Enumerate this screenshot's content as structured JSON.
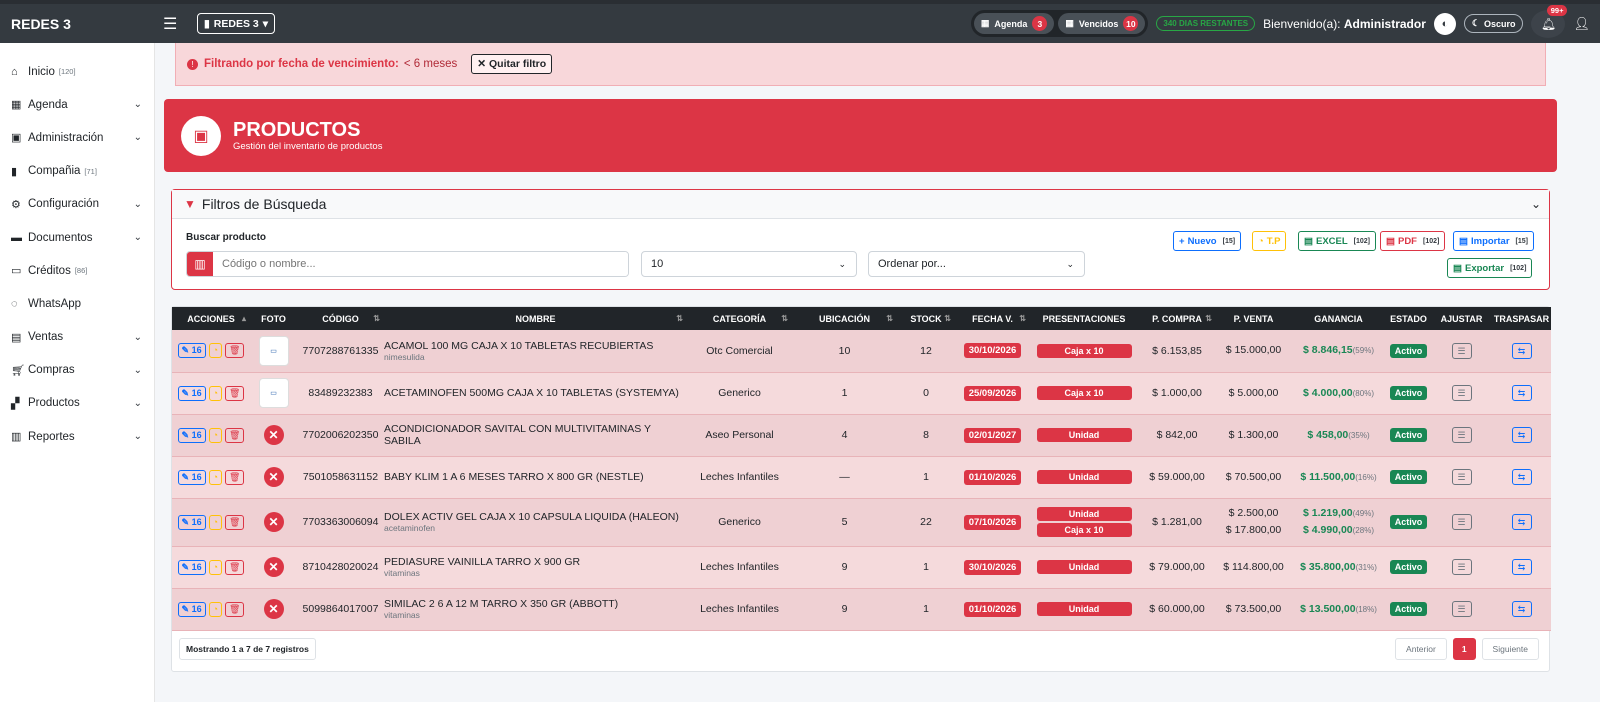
{
  "app": {
    "brand": "REDES 3",
    "company": "REDES 3"
  },
  "topbar": {
    "agenda_label": "Agenda",
    "agenda_count": "3",
    "vencidos_label": "Vencidos",
    "vencidos_count": "10",
    "days_remaining": "340 DIAS RESTANTES",
    "welcome_prefix": "Bienvenido(a):",
    "welcome_user": "Administrador",
    "theme_label": "Oscuro",
    "notif_badge": "99+"
  },
  "sidebar": {
    "items": [
      {
        "label": "Inicio",
        "count": "[120]"
      },
      {
        "label": "Agenda",
        "count": ""
      },
      {
        "label": "Administración",
        "count": ""
      },
      {
        "label": "Compañia",
        "count": "[71]"
      },
      {
        "label": "Configuración",
        "count": ""
      },
      {
        "label": "Documentos",
        "count": ""
      },
      {
        "label": "Créditos",
        "count": "[86]"
      },
      {
        "label": "WhatsApp",
        "count": ""
      },
      {
        "label": "Ventas",
        "count": ""
      },
      {
        "label": "Compras",
        "count": ""
      },
      {
        "label": "Productos",
        "count": ""
      },
      {
        "label": "Reportes",
        "count": ""
      }
    ]
  },
  "alert": {
    "label": "Filtrando por fecha de vencimiento:",
    "value": "< 6 meses",
    "button": "Quitar filtro"
  },
  "header": {
    "title": "PRODUCTOS",
    "subtitle": "Gestión del inventario de productos"
  },
  "filters": {
    "title": "Filtros de Búsqueda",
    "search_label": "Buscar producto",
    "search_placeholder": "Código o nombre...",
    "page_size": "10",
    "order_placeholder": "Ordenar por...",
    "buttons": {
      "nuevo": "Nuevo",
      "nuevo_count": "[15]",
      "tp": "T.P",
      "excel": "EXCEL",
      "excel_count": "[102]",
      "pdf": "PDF",
      "pdf_count": "[102]",
      "importar": "Importar",
      "importar_count": "[15]",
      "exportar": "Exportar",
      "exportar_count": "[102]"
    }
  },
  "table": {
    "headers": [
      "ACCIONES",
      "FOTO",
      "CÓDIGO",
      "NOMBRE",
      "CATEGORÍA",
      "UBICACIÓN",
      "STOCK",
      "FECHA V.",
      "PRESENTACIONES",
      "P. COMPRA",
      "P. VENTA",
      "GANANCIA",
      "ESTADO",
      "AJUSTAR",
      "TRASPASAR"
    ],
    "edit_count": "16",
    "rows": [
      {
        "codigo": "7707288761335",
        "nombre": "ACAMOL 100 MG CAJA X 10 TABLETAS RECUBIERTAS",
        "sub": "nimesulida",
        "categoria": "Otc Comercial",
        "ubicacion": "10",
        "stock": "12",
        "fecha": "30/10/2026",
        "pres": [
          "Caja x 10"
        ],
        "compra": "$ 6.153,85",
        "venta": [
          "$ 15.000,00"
        ],
        "ganancia": [
          "$ 8.846,15"
        ],
        "pct": [
          "(59%)"
        ],
        "estado": "Activo",
        "foto": "img"
      },
      {
        "codigo": "83489232383",
        "nombre": "ACETAMINOFEN 500MG CAJA X 10 TABLETAS (SYSTEMYA)",
        "sub": "",
        "categoria": "Generico",
        "ubicacion": "1",
        "stock": "0",
        "fecha": "25/09/2026",
        "pres": [
          "Caja x 10"
        ],
        "compra": "$ 1.000,00",
        "venta": [
          "$ 5.000,00"
        ],
        "ganancia": [
          "$ 4.000,00"
        ],
        "pct": [
          "(80%)"
        ],
        "estado": "Activo",
        "foto": "img"
      },
      {
        "codigo": "7702006202350",
        "nombre": "ACONDICIONADOR SAVITAL CON MULTIVITAMINAS Y SABILA",
        "sub": "",
        "categoria": "Aseo Personal",
        "ubicacion": "4",
        "stock": "8",
        "fecha": "02/01/2027",
        "pres": [
          "Unidad"
        ],
        "compra": "$ 842,00",
        "venta": [
          "$ 1.300,00"
        ],
        "ganancia": [
          "$ 458,00"
        ],
        "pct": [
          "(35%)"
        ],
        "estado": "Activo",
        "foto": "none"
      },
      {
        "codigo": "7501058631152",
        "nombre": "BABY KLIM 1 A 6 MESES TARRO X 800 GR (NESTLE)",
        "sub": "",
        "categoria": "Leches Infantiles",
        "ubicacion": "—",
        "stock": "1",
        "fecha": "01/10/2026",
        "pres": [
          "Unidad"
        ],
        "compra": "$ 59.000,00",
        "venta": [
          "$ 70.500,00"
        ],
        "ganancia": [
          "$ 11.500,00"
        ],
        "pct": [
          "(16%)"
        ],
        "estado": "Activo",
        "foto": "none"
      },
      {
        "codigo": "7703363006094",
        "nombre": "DOLEX ACTIV GEL CAJA X 10 CAPSULA LIQUIDA (HALEON)",
        "sub": "acetaminofen",
        "categoria": "Generico",
        "ubicacion": "5",
        "stock": "22",
        "fecha": "07/10/2026",
        "pres": [
          "Unidad",
          "Caja x 10"
        ],
        "compra": "$ 1.281,00",
        "venta": [
          "$ 2.500,00",
          "$ 17.800,00"
        ],
        "ganancia": [
          "$ 1.219,00",
          "$ 4.990,00"
        ],
        "pct": [
          "(49%)",
          "(28%)"
        ],
        "estado": "Activo",
        "foto": "none"
      },
      {
        "codigo": "8710428020024",
        "nombre": "PEDIASURE VAINILLA TARRO X 900 GR",
        "sub": "vitaminas",
        "categoria": "Leches Infantiles",
        "ubicacion": "9",
        "stock": "1",
        "fecha": "30/10/2026",
        "pres": [
          "Unidad"
        ],
        "compra": "$ 79.000,00",
        "venta": [
          "$ 114.800,00"
        ],
        "ganancia": [
          "$ 35.800,00"
        ],
        "pct": [
          "(31%)"
        ],
        "estado": "Activo",
        "foto": "none"
      },
      {
        "codigo": "5099864017007",
        "nombre": "SIMILAC 2 6 A 12 M TARRO X 350 GR (ABBOTT)",
        "sub": "vitaminas",
        "categoria": "Leches Infantiles",
        "ubicacion": "9",
        "stock": "1",
        "fecha": "01/10/2026",
        "pres": [
          "Unidad"
        ],
        "compra": "$ 60.000,00",
        "venta": [
          "$ 73.500,00"
        ],
        "ganancia": [
          "$ 13.500,00"
        ],
        "pct": [
          "(18%)"
        ],
        "estado": "Activo",
        "foto": "none"
      }
    ],
    "showing": "Mostrando 1 a 7 de 7 registros",
    "prev": "Anterior",
    "page": "1",
    "next": "Siguiente"
  }
}
